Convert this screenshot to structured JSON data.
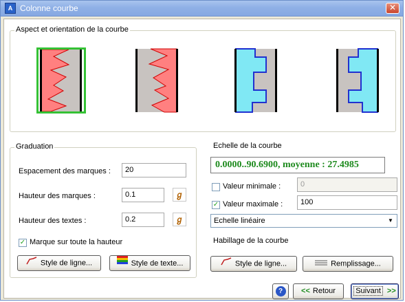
{
  "window": {
    "title": "Colonne courbe",
    "close_glyph": "✕"
  },
  "aspect_group": {
    "legend": "Aspect et orientation de la courbe",
    "options": [
      {
        "name": "red-curve-right",
        "selected": true
      },
      {
        "name": "red-curve-left",
        "selected": false
      },
      {
        "name": "blue-step-left",
        "selected": false
      },
      {
        "name": "blue-step-right",
        "selected": false
      }
    ]
  },
  "graduation": {
    "legend": "Graduation",
    "spacing_label": "Espacement des marques :",
    "spacing_value": "20",
    "mark_height_label": "Hauteur des marques :",
    "mark_height_value": "0.1",
    "text_height_label": "Hauteur des textes :",
    "text_height_value": "0.2",
    "full_height_label": "Marque sur toute la hauteur",
    "full_height_checked": true,
    "line_style_button": "Style de ligne...",
    "text_style_button": "Style de texte..."
  },
  "scale": {
    "legend": "Echelle de la courbe",
    "range_display": "0.0000..90.6900, moyenne : 27.4985",
    "min_label": "Valeur minimale :",
    "min_checked": false,
    "min_value": "0",
    "max_label": "Valeur maximale :",
    "max_checked": true,
    "max_value": "100",
    "scale_type": "Echelle linéaire"
  },
  "dressing": {
    "legend": "Habillage de la courbe",
    "line_style_button": "Style de ligne...",
    "fill_button": "Remplissage..."
  },
  "footer": {
    "help_glyph": "?",
    "back_button": "Retour",
    "back_arrows": "<<",
    "next_button": "Suivant",
    "next_arrows": ">>"
  },
  "colors": {
    "accent_green": "#1d8a1d",
    "curve_red": "#ff8080",
    "curve_cyan": "#80e8f4",
    "curve_blue": "#2030d0"
  }
}
